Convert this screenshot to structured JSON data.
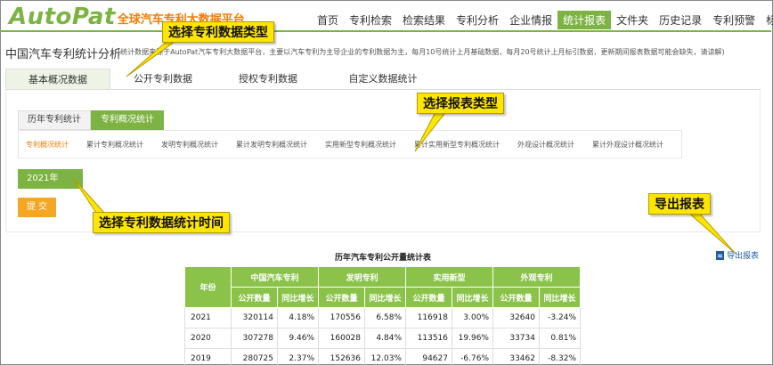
{
  "header": {
    "logo_en": "AutoPat",
    "logo_cn": "全球汽车专利大数据平台",
    "nav": [
      "首页",
      "专利检索",
      "检索结果",
      "专利分析",
      "企业情报",
      "统计报表",
      "文件夹",
      "历史记录",
      "专利预警",
      "标引管理"
    ],
    "active_nav": "统计报表"
  },
  "page": {
    "title": "中国汽车专利统计分析",
    "description": "(统计数据来源于AutoPat汽车专利大数据平台，主要以汽车专利为主导企业的专利数据为主，每月10号统计上月基础数据，每月20号统计上月标引数据，更新期间报表数据可能会缺失，请谅解)"
  },
  "main_tabs": [
    "基本概况数据",
    "公开专利数据",
    "授权专利数据",
    "自定义数据统计"
  ],
  "sub_tabs": [
    "历年专利统计",
    "专利概况统计"
  ],
  "report_types": [
    "专利概况统计",
    "累计专利概况统计",
    "发明专利概况统计",
    "累计发明专利概况统计",
    "实用新型专利概况统计",
    "累计实用新型专利概况统计",
    "外观设计概况统计",
    "累计外观设计概况统计"
  ],
  "year_select": "2021年",
  "submit_label": "提 交",
  "export_label": "导出报表",
  "callouts": {
    "data_type": "选择专利数据类型",
    "report_type": "选择报表类型",
    "time": "选择专利数据统计时间",
    "export": "导出报表"
  },
  "table": {
    "title": "历年汽车专利公开量统计表",
    "year_header": "年份",
    "groups": [
      "中国汽车专利",
      "发明专利",
      "实用新型",
      "外观专利"
    ],
    "sub_headers": [
      "公开数量",
      "同比增长"
    ],
    "rows": [
      {
        "year": "2021",
        "cells": [
          "320114",
          "4.18%",
          "170556",
          "6.58%",
          "116918",
          "3.00%",
          "32640",
          "-3.24%"
        ]
      },
      {
        "year": "2020",
        "cells": [
          "307278",
          "9.46%",
          "160028",
          "4.84%",
          "113516",
          "19.96%",
          "33734",
          "0.81%"
        ]
      },
      {
        "year": "2019",
        "cells": [
          "280725",
          "2.37%",
          "152636",
          "12.03%",
          "94627",
          "-6.76%",
          "33462",
          "-8.32%"
        ]
      }
    ]
  },
  "colors": {
    "brand_green": "#7cb342",
    "orange": "#f57c00",
    "callout_yellow": "#ffe600",
    "callout_arrow_red": "#e53935"
  }
}
